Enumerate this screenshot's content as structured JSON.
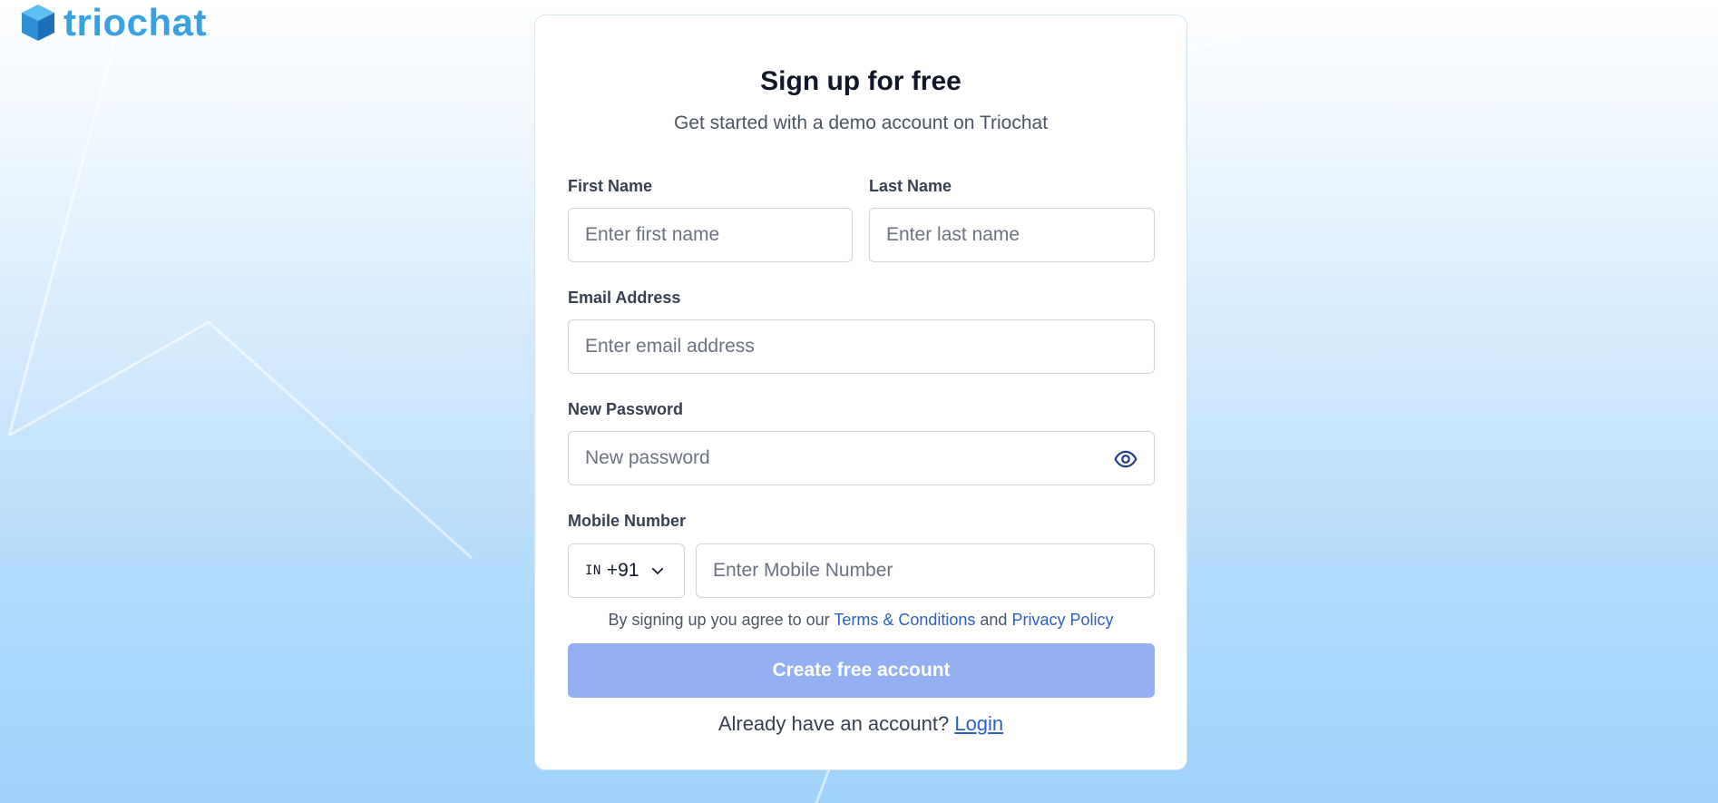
{
  "brand": {
    "name": "triochat",
    "icon": "cube-logo-icon"
  },
  "signup": {
    "title": "Sign up for free",
    "subtitle": "Get started with a demo account on Triochat",
    "first_name": {
      "label": "First Name",
      "placeholder": "Enter first name",
      "value": ""
    },
    "last_name": {
      "label": "Last Name",
      "placeholder": "Enter last name",
      "value": ""
    },
    "email": {
      "label": "Email Address",
      "placeholder": "Enter email address",
      "value": ""
    },
    "password": {
      "label": "New Password",
      "placeholder": "New password",
      "value": "",
      "toggle_icon": "eye-icon"
    },
    "mobile": {
      "label": "Mobile Number",
      "country_code": "IN",
      "dial_code": "+91",
      "placeholder": "Enter Mobile Number",
      "value": ""
    },
    "agreement": {
      "prefix": "By signing up you agree to our ",
      "terms": "Terms & Conditions",
      "and": " and ",
      "privacy": "Privacy Policy"
    },
    "submit_label": "Create free account",
    "login_prompt": "Already have an account? ",
    "login_link": "Login"
  },
  "colors": {
    "brand": "#3aa0e4",
    "link": "#2b5fc7",
    "button_disabled": "#93b1f2"
  }
}
